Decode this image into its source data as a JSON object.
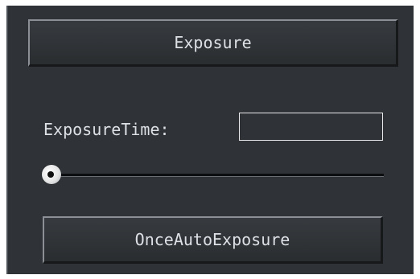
{
  "exposure_panel": {
    "header_button_label": "Exposure",
    "exposure_time_label": "ExposureTime:",
    "exposure_time_value": "",
    "exposure_time_slider_value": 0,
    "once_auto_exposure_label": "OnceAutoExposure"
  },
  "colors": {
    "panel_background": "#2f3337",
    "text": "#dde1e5",
    "input_border": "#e8e8e8"
  }
}
